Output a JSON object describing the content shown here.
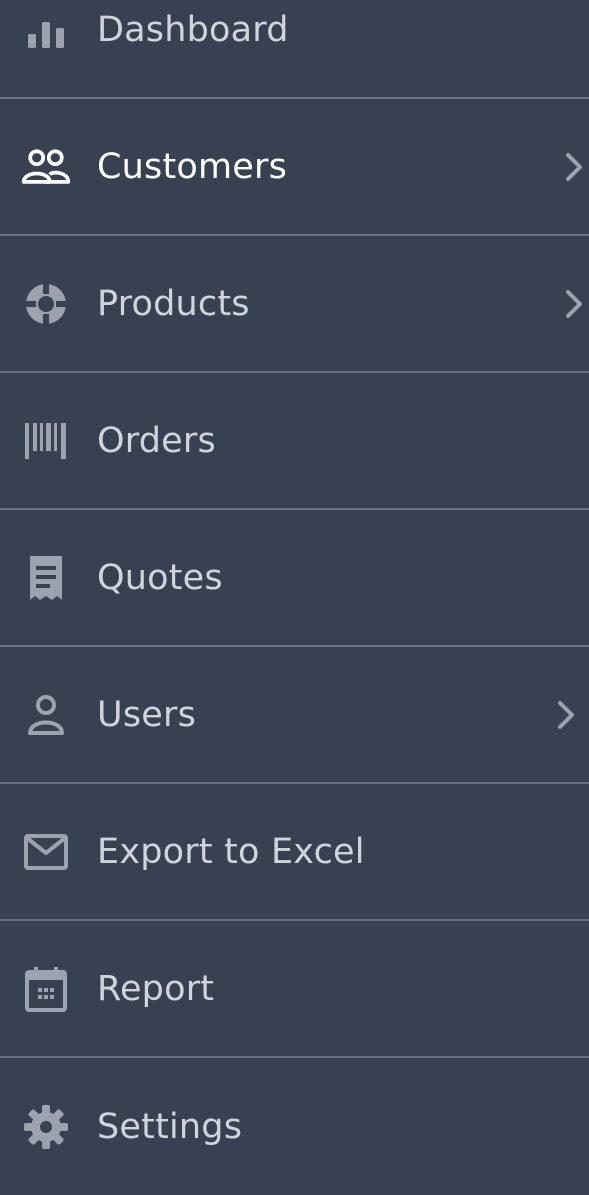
{
  "sidebar": {
    "items": [
      {
        "label": "Dashboard",
        "icon": "chart-bar-icon",
        "has_chevron": false,
        "active": false
      },
      {
        "label": "Customers",
        "icon": "users-icon",
        "has_chevron": true,
        "active": true
      },
      {
        "label": "Products",
        "icon": "lifebuoy-icon",
        "has_chevron": true,
        "active": false
      },
      {
        "label": "Orders",
        "icon": "barcode-icon",
        "has_chevron": false,
        "active": false
      },
      {
        "label": "Quotes",
        "icon": "receipt-icon",
        "has_chevron": false,
        "active": false
      },
      {
        "label": "Users",
        "icon": "user-icon",
        "has_chevron": true,
        "active": false
      },
      {
        "label": "Export to Excel",
        "icon": "envelope-icon",
        "has_chevron": false,
        "active": false
      },
      {
        "label": "Report",
        "icon": "calendar-icon",
        "has_chevron": false,
        "active": false
      },
      {
        "label": "Settings",
        "icon": "gear-icon",
        "has_chevron": false,
        "active": false
      }
    ]
  },
  "colors": {
    "background": "#374151",
    "divider": "#6b7280",
    "text": "#d1d5db",
    "active_text": "#ffffff",
    "icon": "#9ca3af"
  }
}
